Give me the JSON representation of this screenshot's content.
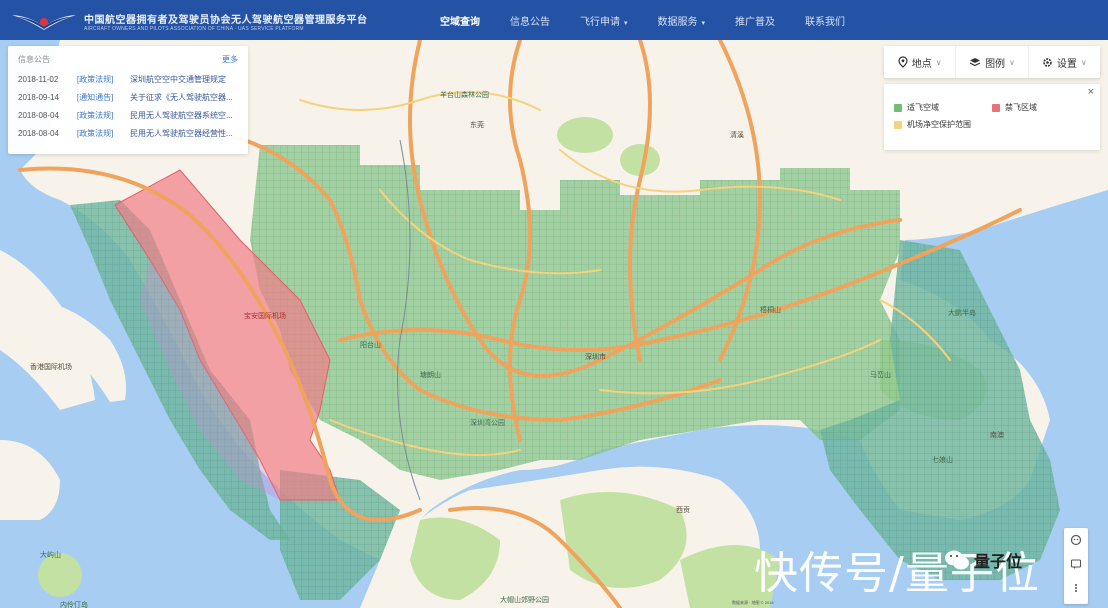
{
  "header": {
    "title": "中国航空器拥有者及驾驶员协会无人驾驶航空器管理服务平台",
    "subtitle": "AIRCRAFT OWNERS AND PILOTS ASSOCIATION OF CHINA · UAS SERVICE PLATFORM",
    "brand_color": "#2453a5"
  },
  "nav": {
    "items": [
      {
        "label": "空域查询",
        "active": true,
        "has_dropdown": false
      },
      {
        "label": "信息公告",
        "active": false,
        "has_dropdown": false
      },
      {
        "label": "飞行申请",
        "active": false,
        "has_dropdown": true
      },
      {
        "label": "数据服务",
        "active": false,
        "has_dropdown": true
      },
      {
        "label": "推广普及",
        "active": false,
        "has_dropdown": false
      },
      {
        "label": "联系我们",
        "active": false,
        "has_dropdown": false
      }
    ],
    "dropdown_caret": "▾"
  },
  "notice_panel": {
    "heading": "信息公告",
    "more_label": "更多",
    "items": [
      {
        "date": "2018-11-02",
        "tag": "[政策法规]",
        "title": "深圳航空空中交通管理规定"
      },
      {
        "date": "2018-09-14",
        "tag": "[通知通告]",
        "title": "关于征求《无人驾驶航空器..."
      },
      {
        "date": "2018-08-04",
        "tag": "[政策法规]",
        "title": "民用无人驾驶航空器系统空..."
      },
      {
        "date": "2018-08-04",
        "tag": "[政策法规]",
        "title": "民用无人驾驶航空器经营性..."
      }
    ]
  },
  "toolbar": {
    "location": {
      "label": "地点",
      "icon": "map-pin-icon"
    },
    "legend": {
      "label": "图例",
      "icon": "layers-icon"
    },
    "settings": {
      "label": "设置",
      "icon": "gear-icon"
    },
    "chevron": "∨"
  },
  "legend": {
    "close_glyph": "×",
    "items": [
      {
        "label": "适飞空域",
        "color": "#6fbf73"
      },
      {
        "label": "禁飞区域",
        "color": "#e8737a"
      },
      {
        "label": "机场净空保护范围",
        "color": "#f3d27a"
      }
    ]
  },
  "map": {
    "colors": {
      "water": "#a7cdf2",
      "land": "#f7f3ea",
      "park": "#c4e1a4",
      "allowed_airspace": "#7fbf86",
      "no_fly": "#f28c92",
      "road_major": "#f0a35c",
      "road_minor": "#f5d27c"
    },
    "labels": [
      {
        "text": "宝安国际机场",
        "kind": "red"
      },
      {
        "text": "深圳湾公园",
        "kind": "green"
      },
      {
        "text": "梧桐山",
        "kind": "green"
      },
      {
        "text": "七娘山",
        "kind": "green"
      },
      {
        "text": "大鹏半岛",
        "kind": "green"
      },
      {
        "text": "羊台山森林公园",
        "kind": "green"
      },
      {
        "text": "阳台山",
        "kind": "green"
      },
      {
        "text": "塘朗山",
        "kind": "green"
      },
      {
        "text": "深圳市",
        "kind": "dark"
      },
      {
        "text": "香港国际机场",
        "kind": "dark"
      },
      {
        "text": "大屿山",
        "kind": "green"
      },
      {
        "text": "西贡",
        "kind": "dark"
      },
      {
        "text": "大帽山郊野公园",
        "kind": "green"
      },
      {
        "text": "内伶仃岛",
        "kind": "green"
      },
      {
        "text": "东莞",
        "kind": "dark"
      },
      {
        "text": "清溪",
        "kind": "dark"
      },
      {
        "text": "马峦山",
        "kind": "green"
      },
      {
        "text": "南澳",
        "kind": "dark"
      }
    ]
  },
  "float_tools": [
    {
      "icon": "customer-service-icon"
    },
    {
      "icon": "feedback-icon"
    },
    {
      "icon": "more-icon"
    }
  ],
  "watermark": {
    "text": "快传号/量子位",
    "wechat_label": "量子位"
  },
  "scale_text": "数据来源 · 地图 © 2018"
}
